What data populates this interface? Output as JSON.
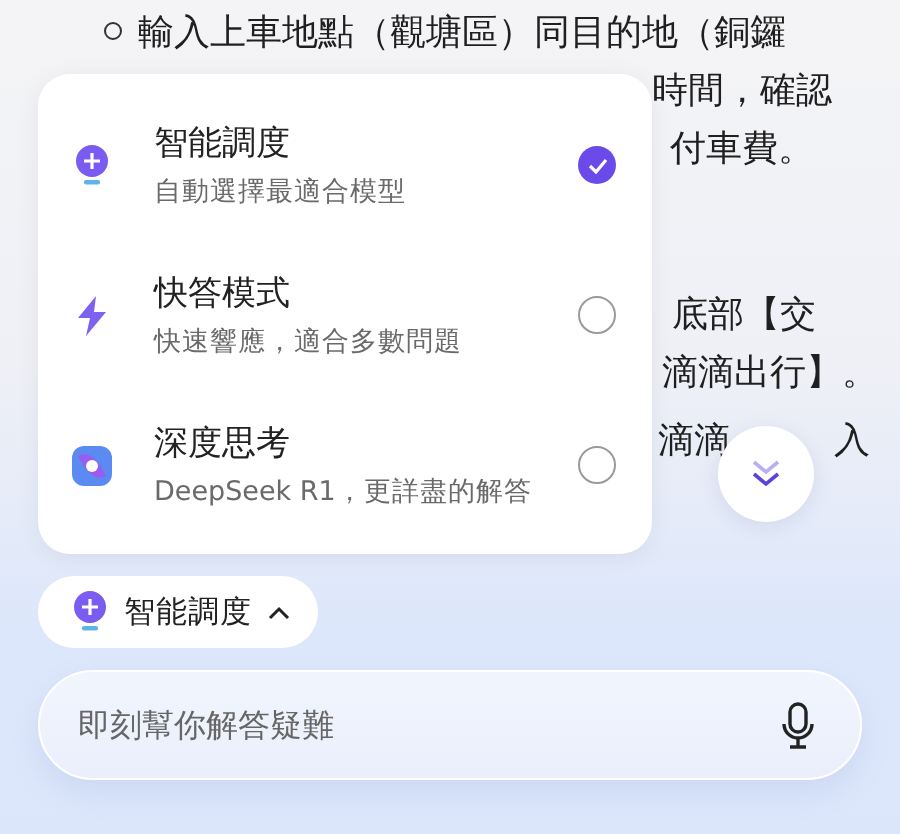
{
  "background_text": [
    {
      "text": "輸入上車地點（觀塘區）同目的地（銅鑼",
      "bullet": true
    },
    {
      "text": "時間，確認",
      "bullet": false
    },
    {
      "text": "付車費。",
      "bullet": false
    },
    {
      "text": "底部【交",
      "bullet": false
    },
    {
      "text": "滴滴出行】。",
      "bullet": false
    },
    {
      "text": "滴滴",
      "bullet": false,
      "tail": "入"
    }
  ],
  "model_menu": {
    "items": [
      {
        "kind": "smart",
        "title": "智能調度",
        "subtitle": "自動選擇最適合模型",
        "selected": true
      },
      {
        "kind": "fast",
        "title": "快答模式",
        "subtitle": "快速響應，適合多數問題",
        "selected": false
      },
      {
        "kind": "deep",
        "title": "深度思考",
        "subtitle": "DeepSeek R1，更詳盡的解答",
        "selected": false
      }
    ]
  },
  "model_chip": {
    "label": "智能調度",
    "expanded": true
  },
  "input": {
    "placeholder": "即刻幫你解答疑難"
  }
}
